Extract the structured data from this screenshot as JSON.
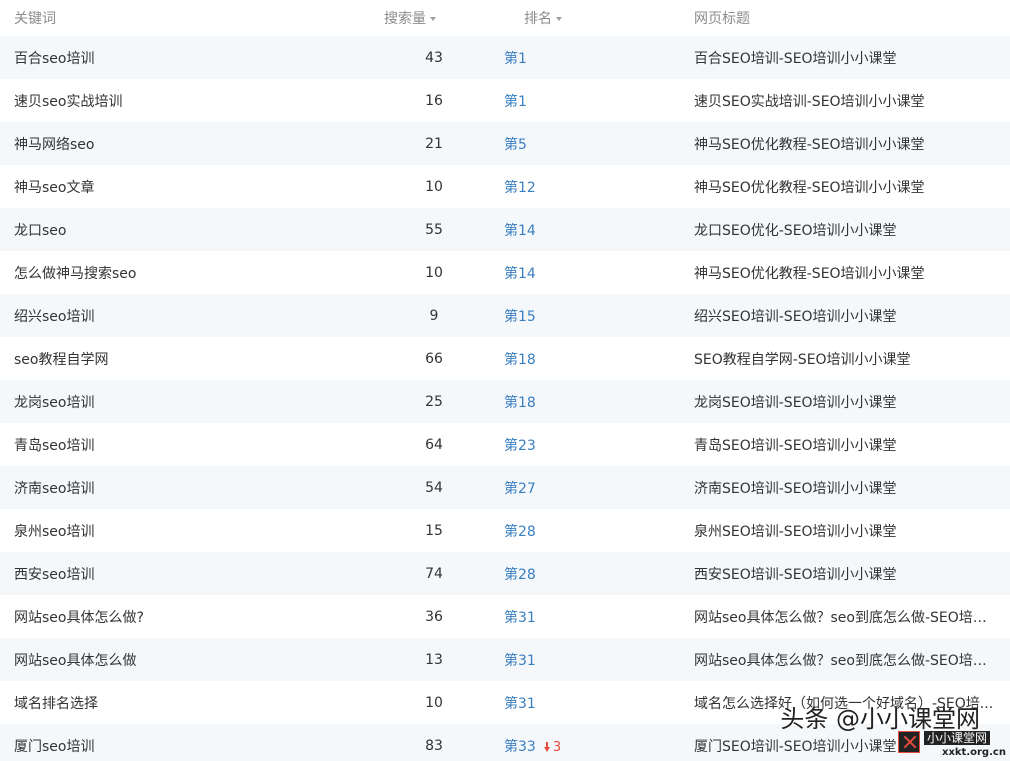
{
  "header": {
    "keyword": "关键词",
    "volume": "搜索量",
    "rank": "排名",
    "title": "网页标题"
  },
  "rows": [
    {
      "keyword": "百合seo培训",
      "volume": "43",
      "rank": "第1",
      "title": "百合SEO培训-SEO培训小小课堂"
    },
    {
      "keyword": "速贝seo实战培训",
      "volume": "16",
      "rank": "第1",
      "title": "速贝SEO实战培训-SEO培训小小课堂"
    },
    {
      "keyword": "神马网络seo",
      "volume": "21",
      "rank": "第5",
      "title": "神马SEO优化教程-SEO培训小小课堂"
    },
    {
      "keyword": "神马seo文章",
      "volume": "10",
      "rank": "第12",
      "title": "神马SEO优化教程-SEO培训小小课堂"
    },
    {
      "keyword": "龙口seo",
      "volume": "55",
      "rank": "第14",
      "title": "龙口SEO优化-SEO培训小小课堂"
    },
    {
      "keyword": "怎么做神马搜索seo",
      "volume": "10",
      "rank": "第14",
      "title": "神马SEO优化教程-SEO培训小小课堂"
    },
    {
      "keyword": "绍兴seo培训",
      "volume": "9",
      "rank": "第15",
      "title": "绍兴SEO培训-SEO培训小小课堂"
    },
    {
      "keyword": "seo教程自学网",
      "volume": "66",
      "rank": "第18",
      "title": "SEO教程自学网-SEO培训小小课堂"
    },
    {
      "keyword": "龙岗seo培训",
      "volume": "25",
      "rank": "第18",
      "title": "龙岗SEO培训-SEO培训小小课堂"
    },
    {
      "keyword": "青岛seo培训",
      "volume": "64",
      "rank": "第23",
      "title": "青岛SEO培训-SEO培训小小课堂"
    },
    {
      "keyword": "济南seo培训",
      "volume": "54",
      "rank": "第27",
      "title": "济南SEO培训-SEO培训小小课堂"
    },
    {
      "keyword": "泉州seo培训",
      "volume": "15",
      "rank": "第28",
      "title": "泉州SEO培训-SEO培训小小课堂"
    },
    {
      "keyword": "西安seo培训",
      "volume": "74",
      "rank": "第28",
      "title": "西安SEO培训-SEO培训小小课堂"
    },
    {
      "keyword": "网站seo具体怎么做?",
      "volume": "36",
      "rank": "第31",
      "title": "网站seo具体怎么做？seo到底怎么做-SEO培训..."
    },
    {
      "keyword": "网站seo具体怎么做",
      "volume": "13",
      "rank": "第31",
      "title": "网站seo具体怎么做？seo到底怎么做-SEO培训..."
    },
    {
      "keyword": "域名排名选择",
      "volume": "10",
      "rank": "第31",
      "title": "域名怎么选择好（如何选一个好域名）-SEO培..."
    },
    {
      "keyword": "厦门seo培训",
      "volume": "83",
      "rank": "第33",
      "rank_change": "3",
      "title": "厦门SEO培训-SEO培训小小课堂"
    }
  ],
  "watermark": {
    "text": "头条 @小小课堂网",
    "logo_name": "小小课堂网",
    "logo_url": "xxkt.org.cn"
  },
  "colors": {
    "rank": "#3a7fc1",
    "rank_down": "#e64b3c",
    "stripe": "#f5f8fb",
    "header_text": "#8c8c8c"
  }
}
